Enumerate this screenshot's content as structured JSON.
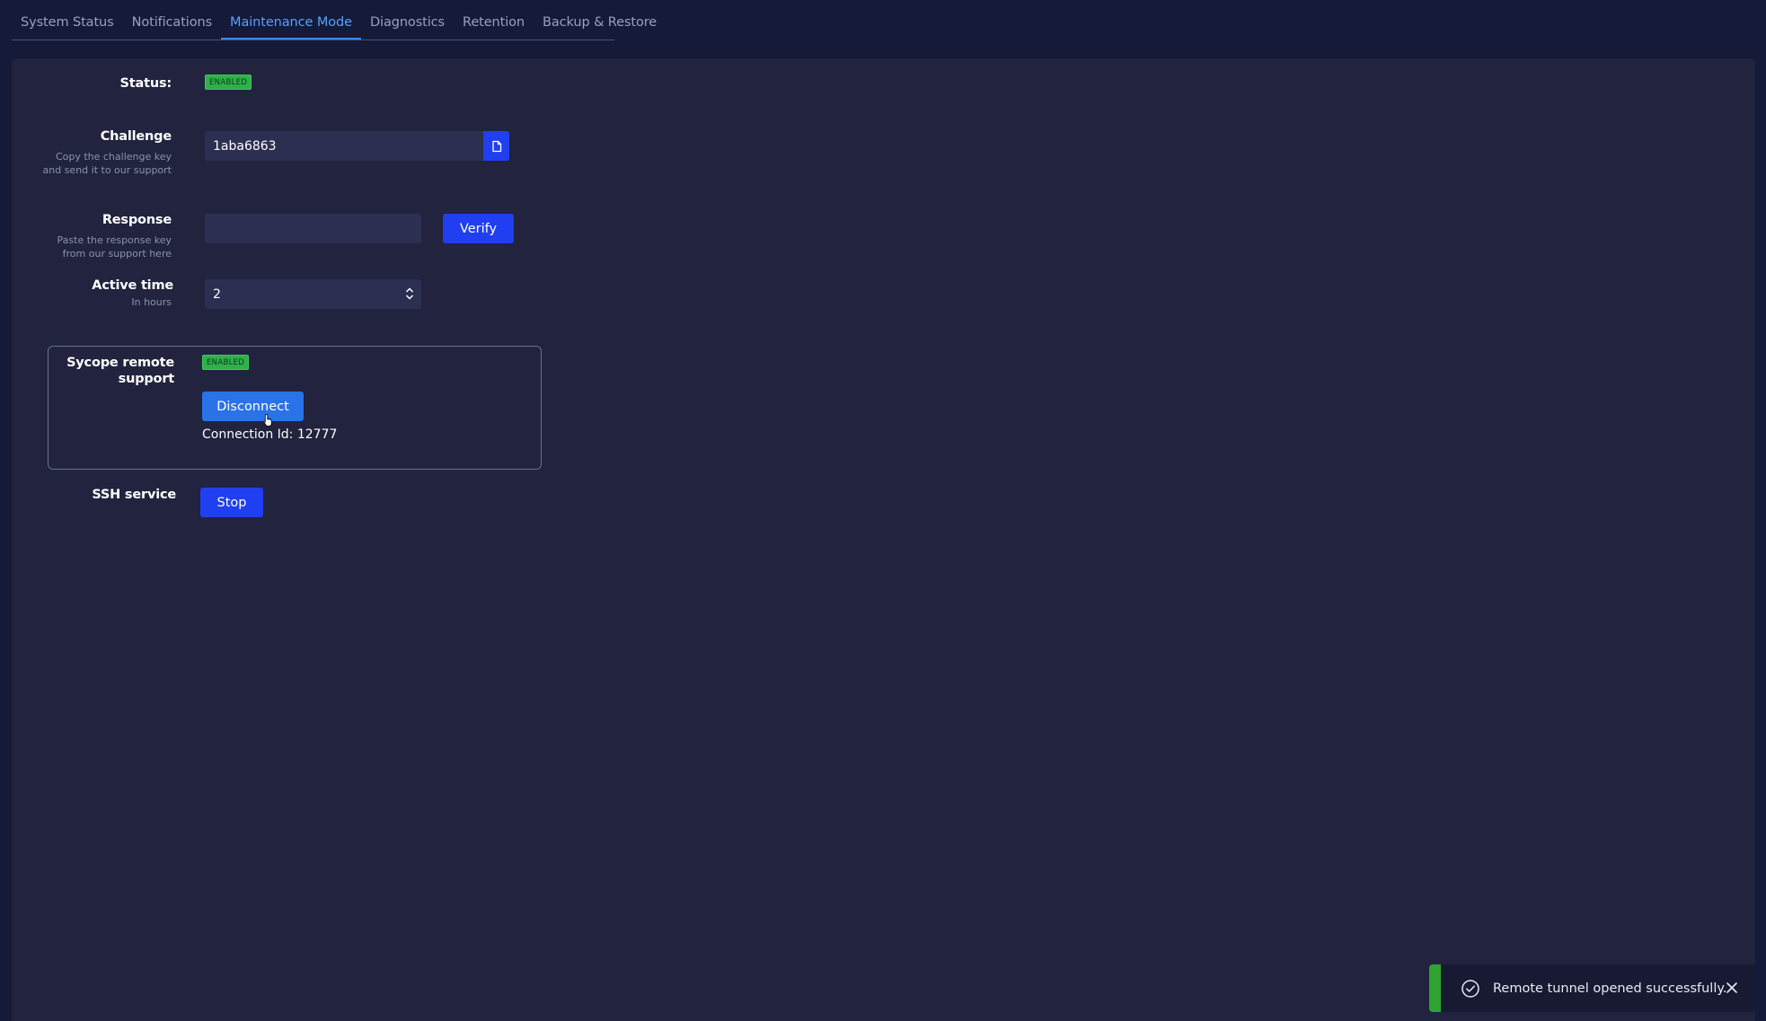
{
  "tabs": [
    {
      "label": "System Status"
    },
    {
      "label": "Notifications"
    },
    {
      "label": "Maintenance Mode"
    },
    {
      "label": "Diagnostics"
    },
    {
      "label": "Retention"
    },
    {
      "label": "Backup & Restore"
    }
  ],
  "active_tab": "Maintenance Mode",
  "status": {
    "label": "Status:",
    "badge": "ENABLED"
  },
  "challenge": {
    "label": "Challenge",
    "hint_line1": "Copy the challenge key",
    "hint_line2": "and send it to our support",
    "value": "1aba6863",
    "copy_icon": "copy-icon"
  },
  "response": {
    "label": "Response",
    "hint_line1": "Paste the response key",
    "hint_line2": "from our support here",
    "value": "",
    "verify_label": "Verify"
  },
  "active_time": {
    "label": "Active time",
    "hint": "In hours",
    "value": "2"
  },
  "remote_support": {
    "label_line1": "Sycope remote",
    "label_line2": "support",
    "badge": "ENABLED",
    "disconnect_label": "Disconnect",
    "connection_text": "Connection Id: 12777"
  },
  "ssh": {
    "label": "SSH service",
    "stop_label": "Stop"
  },
  "toast": {
    "message": "Remote tunnel opened successfully.",
    "status_color": "#2fa32f"
  },
  "colors": {
    "accent": "#1f3ff0",
    "badge_green": "#2fb04a",
    "tab_active": "#5aa0ff",
    "background": "#141a38",
    "panel": "#21233f"
  }
}
